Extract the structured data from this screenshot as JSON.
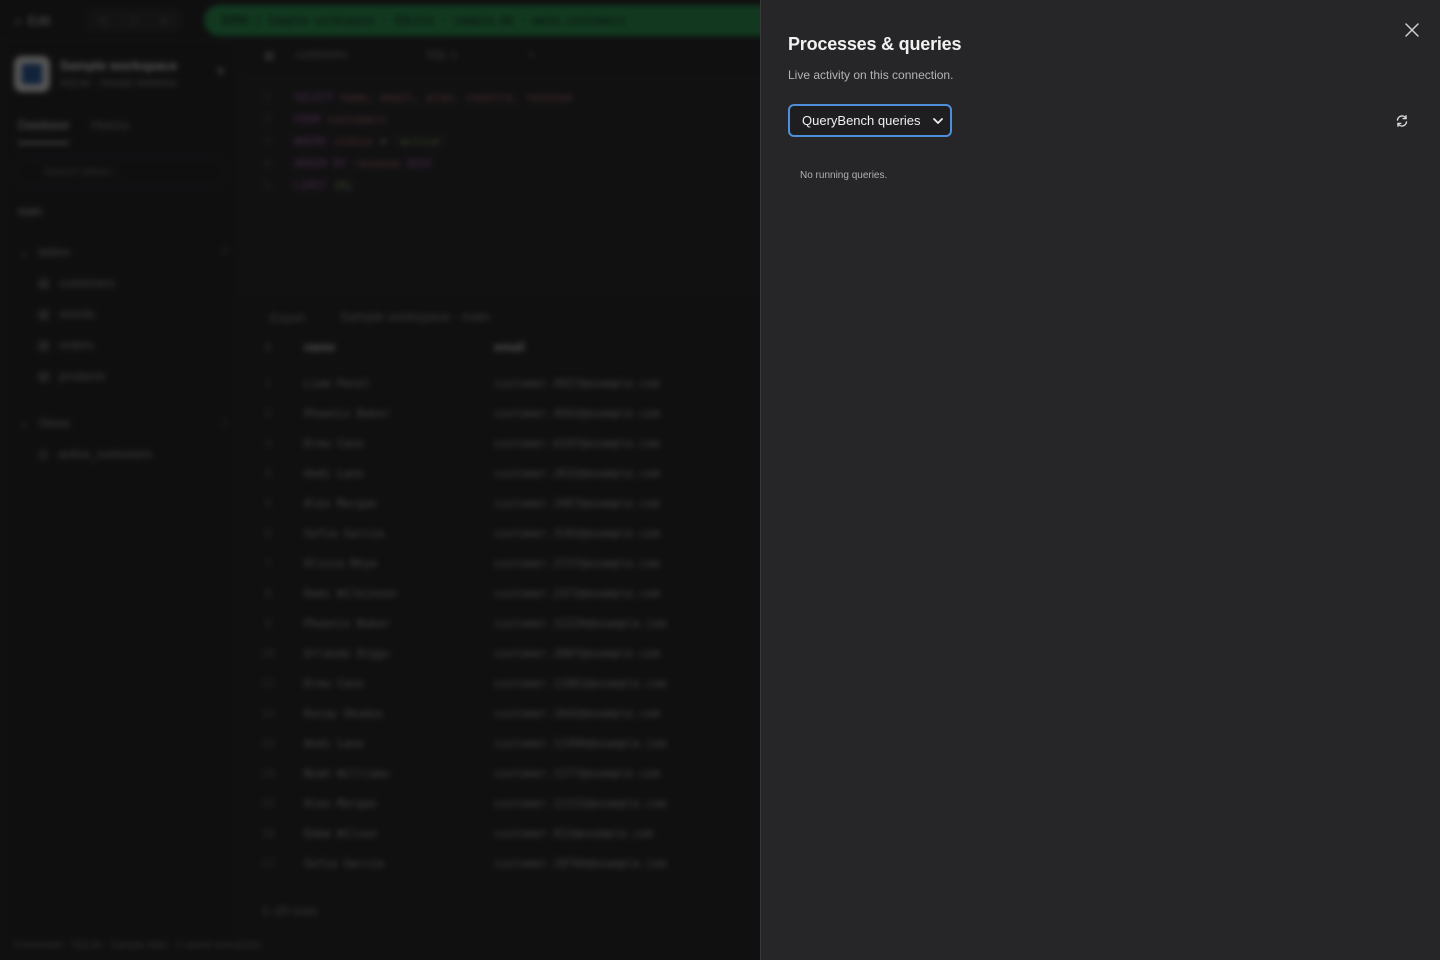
{
  "background": {
    "edit_label": "Edit",
    "connection_pill": "DEMO | Sample workspace · SQLite · sample.db · main.customers",
    "workspace_name": "Sample workspace",
    "workspace_sub": "SQLite · Sample database",
    "tabs": {
      "database": "Database",
      "history": "History"
    },
    "search_placeholder": "Search tables...",
    "schema": "main",
    "tree": {
      "tables_label": "tables",
      "tables_count": "4",
      "tables": [
        "customers",
        "events",
        "orders",
        "products"
      ],
      "views_label": "Views",
      "views_count": "1",
      "views": [
        "active_customers"
      ]
    },
    "editor_tabs": [
      "customers",
      "SQL 1"
    ],
    "results_export": "Export",
    "results_context": "Sample workspace · main",
    "grid_headers": [
      "#",
      "name",
      "email"
    ],
    "grid_rows": [
      [
        "1",
        "Liam Patel",
        "customer.4927@example.com"
      ],
      [
        "2",
        "Phoenix Baker",
        "customer.4562@example.com"
      ],
      [
        "3",
        "Drew Cano",
        "customer.6197@example.com"
      ],
      [
        "4",
        "Andi Lane",
        "customer.2632@example.com"
      ],
      [
        "5",
        "Alex Morgan",
        "customer.3467@example.com"
      ],
      [
        "6",
        "Sofia Garcia",
        "customer.3102@example.com"
      ],
      [
        "7",
        "Olivia Rhye",
        "customer.2737@example.com"
      ],
      [
        "8",
        "Demi Wilkinson",
        "customer.2372@example.com"
      ],
      [
        "9",
        "Phoenix Baker",
        "customer.12226@example.com"
      ],
      [
        "10",
        "Orlando Diggs",
        "customer.2007@example.com"
      ],
      [
        "11",
        "Drew Cano",
        "customer.11861@example.com"
      ],
      [
        "12",
        "Kocay Okumus",
        "customer.1642@example.com"
      ],
      [
        "13",
        "Andi Lane",
        "customer.11496@example.com"
      ],
      [
        "14",
        "Noah Williams",
        "customer.1277@example.com"
      ],
      [
        "15",
        "Alex Morgan",
        "customer.11131@example.com"
      ],
      [
        "16",
        "Emma Wilson",
        "customer.912@example.com"
      ],
      [
        "17",
        "Sofia Garcia",
        "customer.10766@example.com"
      ]
    ],
    "rows_count": "1–20 rows",
    "statusbar": "Connected · SQLite · Sample data · 1 saved connection"
  },
  "drawer": {
    "title": "Processes & queries",
    "subtitle": "Live activity on this connection.",
    "filter_selected": "QueryBench queries",
    "empty_message": "No running queries."
  },
  "colors": {
    "accent_focus": "#4f8fd9",
    "connection_green": "#1e8a45",
    "drawer_bg": "#262628"
  }
}
